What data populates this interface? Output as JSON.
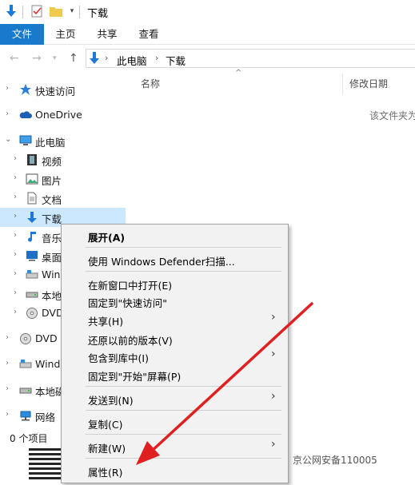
{
  "titlebar": {
    "title": "下载",
    "icons": [
      "download-arrow-icon",
      "properties-icon",
      "new-folder-icon",
      "qat-dropdown-icon"
    ]
  },
  "ribbon": {
    "tabs": [
      {
        "label": "文件"
      },
      {
        "label": "主页"
      },
      {
        "label": "共享"
      },
      {
        "label": "查看"
      }
    ]
  },
  "addressbar": {
    "path": [
      "此电脑",
      "下载"
    ]
  },
  "navpane": {
    "items": [
      {
        "label": "快速访问",
        "icon": "star-icon"
      },
      {
        "label": "OneDrive",
        "icon": "cloud-icon"
      },
      {
        "label": "此电脑",
        "icon": "computer-icon"
      },
      {
        "label": "视频",
        "icon": "video-icon"
      },
      {
        "label": "图片",
        "icon": "picture-icon"
      },
      {
        "label": "文档",
        "icon": "document-icon"
      },
      {
        "label": "下载",
        "icon": "download-icon"
      },
      {
        "label": "音乐",
        "icon": "music-icon"
      },
      {
        "label": "桌面",
        "icon": "desktop-icon"
      },
      {
        "label": "Wind",
        "icon": "windows-drive-icon"
      },
      {
        "label": "本地",
        "icon": "drive-icon"
      },
      {
        "label": "DVD",
        "icon": "dvd-icon"
      },
      {
        "label": "DVD",
        "icon": "dvd-icon"
      },
      {
        "label": "Wind",
        "icon": "windows-drive-icon"
      },
      {
        "label": "本地磁",
        "icon": "drive-icon"
      },
      {
        "label": "网络",
        "icon": "network-icon"
      }
    ]
  },
  "content": {
    "columns": [
      "名称",
      "修改日期"
    ],
    "empty_message": "该文件夹为"
  },
  "status": {
    "text": "0 个项目"
  },
  "watermark": {
    "text": "京公网安备110005"
  },
  "context_menu": {
    "items": [
      {
        "label": "展开(A)"
      },
      {
        "label": "使用 Windows Defender扫描..."
      },
      {
        "label": "在新窗口中打开(E)"
      },
      {
        "label": "固定到\"快速访问\""
      },
      {
        "label": "共享(H)"
      },
      {
        "label": "还原以前的版本(V)"
      },
      {
        "label": "包含到库中(I)"
      },
      {
        "label": "固定到\"开始\"屏幕(P)"
      },
      {
        "label": "发送到(N)"
      },
      {
        "label": "复制(C)"
      },
      {
        "label": "新建(W)"
      },
      {
        "label": "属性(R)"
      }
    ]
  },
  "colors": {
    "accent": "#1979ca",
    "selection": "#cce8ff",
    "annotation": "#e02020"
  }
}
